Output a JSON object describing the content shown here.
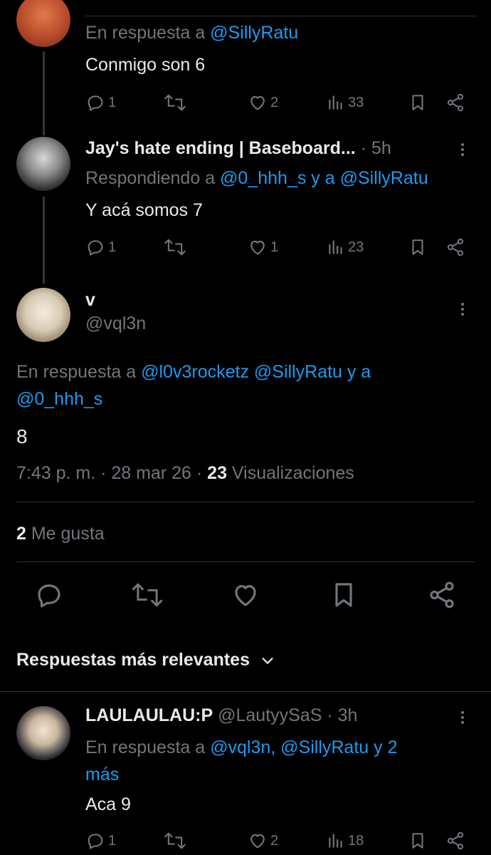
{
  "reply1": {
    "in_reply_prefix": "En respuesta a ",
    "in_reply_to": "@SillyRatu",
    "text": "Conmigo son 6",
    "replies": "1",
    "likes": "2",
    "views": "33"
  },
  "reply2": {
    "name": "Jay's hate ending | Baseboard...",
    "time": "· 5h",
    "replying_prefix": "Respondiendo a ",
    "replying_to": "@0_hhh_s y a @SillyRatu",
    "text": "Y acá somos 7",
    "replies": "1",
    "likes": "1",
    "views": "23"
  },
  "main": {
    "name": "v",
    "handle": "@vql3n",
    "in_reply_prefix": "En respuesta a ",
    "in_reply_line1": "@l0v3rocketz @SillyRatu y a",
    "in_reply_line2": "@0_hhh_s",
    "text": "8",
    "meta_time": "7:43 p. m. · 28 mar 26 · ",
    "views_count": "23",
    "views_label": " Visualizaciones",
    "likes_count": "2",
    "likes_label": " Me gusta"
  },
  "sort": {
    "label": "Respuestas más relevantes"
  },
  "reply3": {
    "name": "LAULAULAU:P",
    "handle_time": "@LautyySaS · 3h",
    "in_reply_prefix": "En respuesta a ",
    "in_reply_line1": "@vql3n, @SillyRatu y 2",
    "in_reply_line2": "más",
    "text": "Aca 9",
    "replies": "1",
    "likes": "2",
    "views": "18"
  },
  "colors": {
    "background": "#000000",
    "accent": "#1d9bf0",
    "secondary_text": "#71767b",
    "divider": "#2f3336"
  }
}
